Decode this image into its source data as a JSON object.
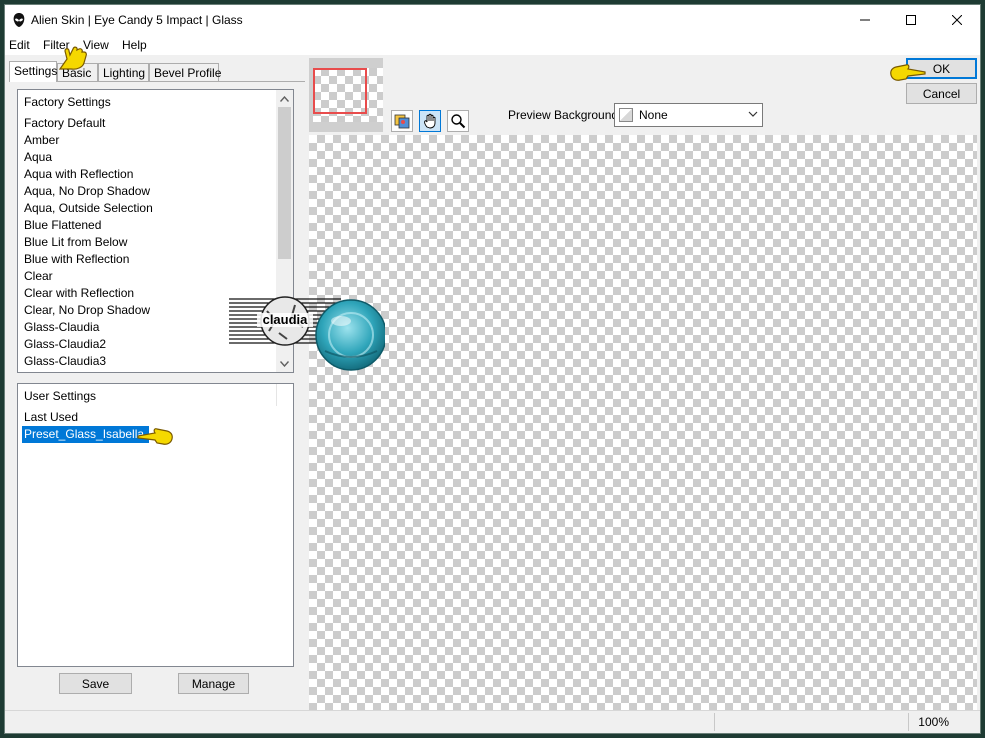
{
  "window": {
    "title": "Alien Skin | Eye Candy 5 Impact | Glass",
    "icon": "alien-skin-icon"
  },
  "menu": [
    "Edit",
    "Filter",
    "View",
    "Help"
  ],
  "tabs": [
    "Settings",
    "Basic",
    "Lighting",
    "Bevel Profile"
  ],
  "factory_settings": {
    "header": "Factory Settings",
    "items": [
      "Factory Default",
      "Amber",
      "Aqua",
      "Aqua with Reflection",
      "Aqua, No Drop Shadow",
      "Aqua, Outside Selection",
      "Blue Flattened",
      "Blue Lit from Below",
      "Blue with Reflection",
      "Clear",
      "Clear with Reflection",
      "Clear, No Drop Shadow",
      "Glass-Claudia",
      "Glass-Claudia2",
      "Glass-Claudia3"
    ]
  },
  "user_settings": {
    "header": "User Settings",
    "items": [
      "Last Used",
      "Preset_Glass_Isabella"
    ],
    "selected": "Preset_Glass_Isabella"
  },
  "buttons": {
    "save": "Save",
    "manage": "Manage",
    "ok": "OK",
    "cancel": "Cancel"
  },
  "preview_background": {
    "label": "Preview Background:",
    "value": "None"
  },
  "status": {
    "zoom": "100%"
  },
  "watermark": {
    "text": "claudia"
  },
  "colors": {
    "selection": "#0078d7",
    "accent_pointer": "#f5d800",
    "nav_rect": "#e84c4c"
  }
}
